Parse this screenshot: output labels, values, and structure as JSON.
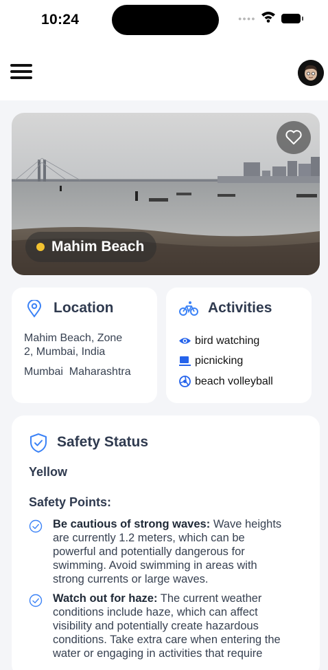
{
  "status_bar": {
    "time": "10:24"
  },
  "beach": {
    "name": "Mahim Beach",
    "status_dot_color": "#f2c230"
  },
  "location": {
    "title": "Location",
    "address_line1": "Mahim Beach, Zone",
    "address_line2": "2, Mumbai, India",
    "city": "Mumbai",
    "state": "Maharashtra"
  },
  "activities": {
    "title": "Activities",
    "items": [
      {
        "label": "bird watching",
        "icon": "eye-icon"
      },
      {
        "label": "picnicking",
        "icon": "cup-icon"
      },
      {
        "label": "beach volleyball",
        "icon": "volleyball-icon"
      }
    ]
  },
  "safety": {
    "title": "Safety Status",
    "level": "Yellow",
    "points_title": "Safety Points:",
    "points": [
      {
        "heading": "Be cautious of strong waves:",
        "lines": [
          "Wave heights",
          "are currently 1.2 meters, which can be",
          "powerful and potentially dangerous for",
          "swimming. Avoid swimming in areas with",
          "strong currents or large waves."
        ]
      },
      {
        "heading": "Watch out for haze:",
        "lines": [
          "The current weather",
          "conditions include haze, which can affect",
          "visibility and potentially create hazardous",
          "conditions. Take extra care when entering the",
          "water or engaging in activities that require"
        ]
      }
    ]
  },
  "colors": {
    "accent_blue": "#3b82f6",
    "title_navy": "#2f3a4f",
    "page_bg": "#f4f5f8"
  }
}
